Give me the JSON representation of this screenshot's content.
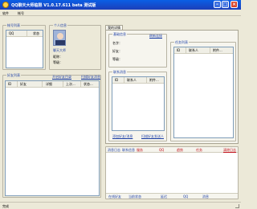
{
  "window": {
    "title": "QQ聊天大师临限 V1.0.17.611 beta 测试版"
  },
  "menu": {
    "items": [
      "软件",
      "帐号"
    ]
  },
  "account_list": {
    "group_label": "帐号列表",
    "columns": [
      "QQ",
      "状态"
    ]
  },
  "profile": {
    "group_label": "个人信息",
    "name": "聊天大师",
    "fields": [
      "昵称：",
      "等级："
    ]
  },
  "friends": {
    "group_label": "好友列表",
    "links": [
      "开启好友目录",
      "扫描好友消息"
    ],
    "columns": [
      "ID",
      "好友",
      "详细",
      "上次...",
      "状态..."
    ]
  },
  "right_panel": {
    "tab_label": "我的详情",
    "basic": {
      "group_label": "基础信息",
      "refresh_link": "刷新连接",
      "fields": [
        "名字：",
        "好友：",
        "等级："
      ]
    },
    "contacts": {
      "group_label": "联系消息",
      "columns": [
        "ID",
        "联系人",
        "附件..."
      ],
      "links": [
        "添加好友/消息",
        "扫描好友发送人"
      ]
    },
    "tasks": {
      "group_label": "任务列表",
      "columns": [
        "ID",
        "联系人",
        "附件..."
      ]
    }
  },
  "log": {
    "header_links": [
      "消息日志",
      "联系信息",
      "服务",
      "QQ",
      "趋势",
      "任务"
    ],
    "clear_link": "清除日志",
    "footer_items": [
      "在线好友",
      "当前状态",
      "延迟",
      "QQ",
      "消息"
    ]
  },
  "status": {
    "text": "完成"
  }
}
